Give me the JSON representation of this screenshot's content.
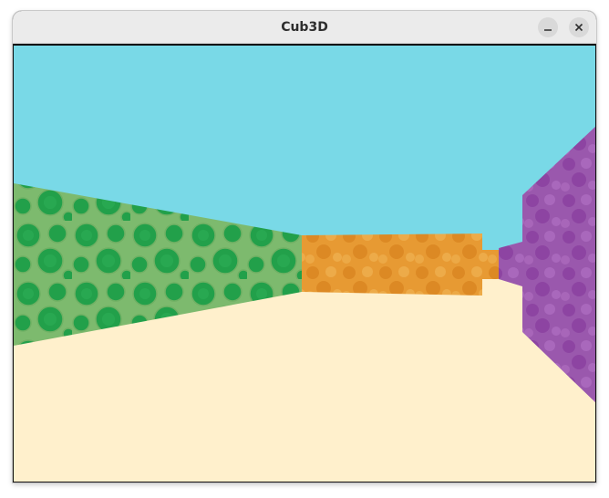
{
  "window": {
    "title": "Cub3D",
    "minimize_icon": "minimize-icon",
    "close_icon": "close-icon"
  },
  "scene": {
    "ceiling_color": "#79d9e7",
    "floor_color": "#fff0cc",
    "walls": [
      {
        "name": "left-wall",
        "texture": "green-circles",
        "base": "#7dba6e",
        "spot": "#1f9e48"
      },
      {
        "name": "front-wall",
        "texture": "orange-stone",
        "base": "#e79a33",
        "spot": "#d98521"
      },
      {
        "name": "far-wall",
        "texture": "purple-stone",
        "base": "#9a58ad",
        "spot": "#8a3f9f"
      },
      {
        "name": "right-wall",
        "texture": "purple-stone",
        "base": "#9a58ad",
        "spot": "#8a3f9f"
      }
    ]
  }
}
